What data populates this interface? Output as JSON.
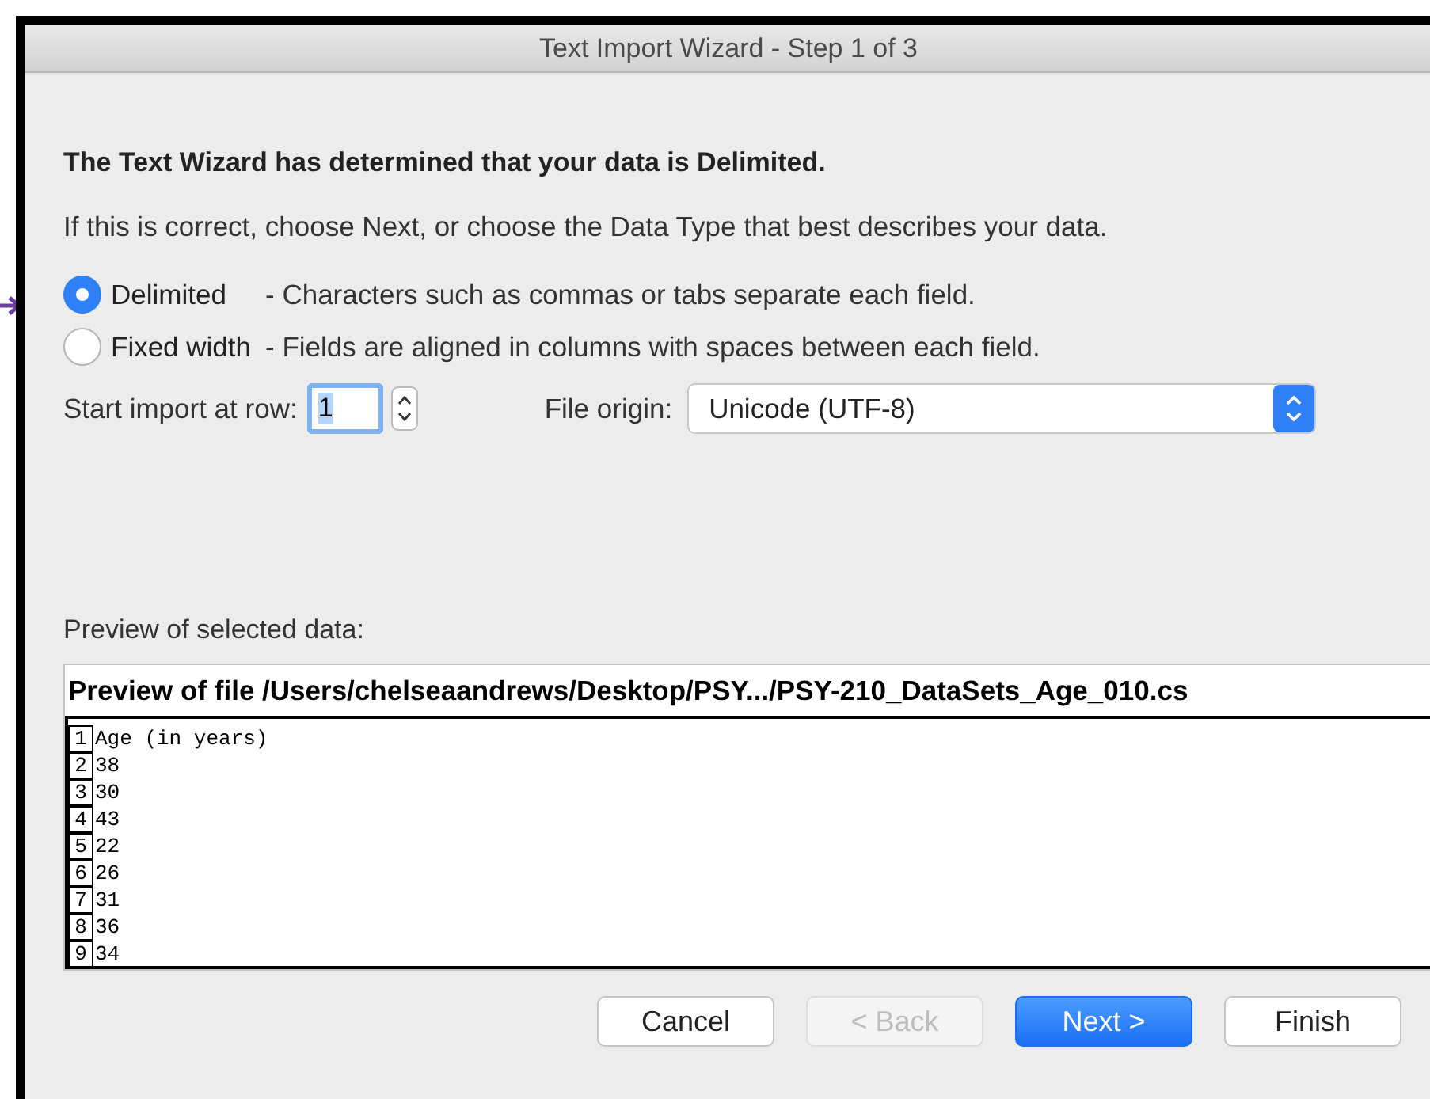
{
  "window": {
    "title": "Text Import Wizard - Step 1 of 3"
  },
  "heading": "The Text Wizard has determined that your data is Delimited.",
  "instruction": "If this is correct, choose Next, or choose the Data Type that best describes your data.",
  "data_types": [
    {
      "label": "Delimited",
      "description": "- Characters such as commas or tabs separate each field.",
      "selected": true
    },
    {
      "label": "Fixed width",
      "description": "- Fields are aligned in columns with spaces between each field.",
      "selected": false
    }
  ],
  "start_row": {
    "label": "Start import at row:",
    "value": "1"
  },
  "file_origin": {
    "label": "File origin:",
    "value": "Unicode (UTF-8)"
  },
  "preview": {
    "label": "Preview of selected data:",
    "header": "Preview of file /Users/chelseaandrews/Desktop/PSY.../PSY-210_DataSets_Age_010.cs",
    "rows": [
      {
        "number": "1",
        "text": "Age (in years)"
      },
      {
        "number": "2",
        "text": "38"
      },
      {
        "number": "3",
        "text": "30"
      },
      {
        "number": "4",
        "text": "43"
      },
      {
        "number": "5",
        "text": "22"
      },
      {
        "number": "6",
        "text": "26"
      },
      {
        "number": "7",
        "text": "31"
      },
      {
        "number": "8",
        "text": "36"
      },
      {
        "number": "9",
        "text": "34"
      }
    ]
  },
  "buttons": [
    {
      "label": "Cancel",
      "kind": "normal",
      "disabled": false
    },
    {
      "label": "< Back",
      "kind": "normal",
      "disabled": true
    },
    {
      "label": "Next >",
      "kind": "default",
      "disabled": false
    },
    {
      "label": "Finish",
      "kind": "normal",
      "disabled": false
    }
  ]
}
